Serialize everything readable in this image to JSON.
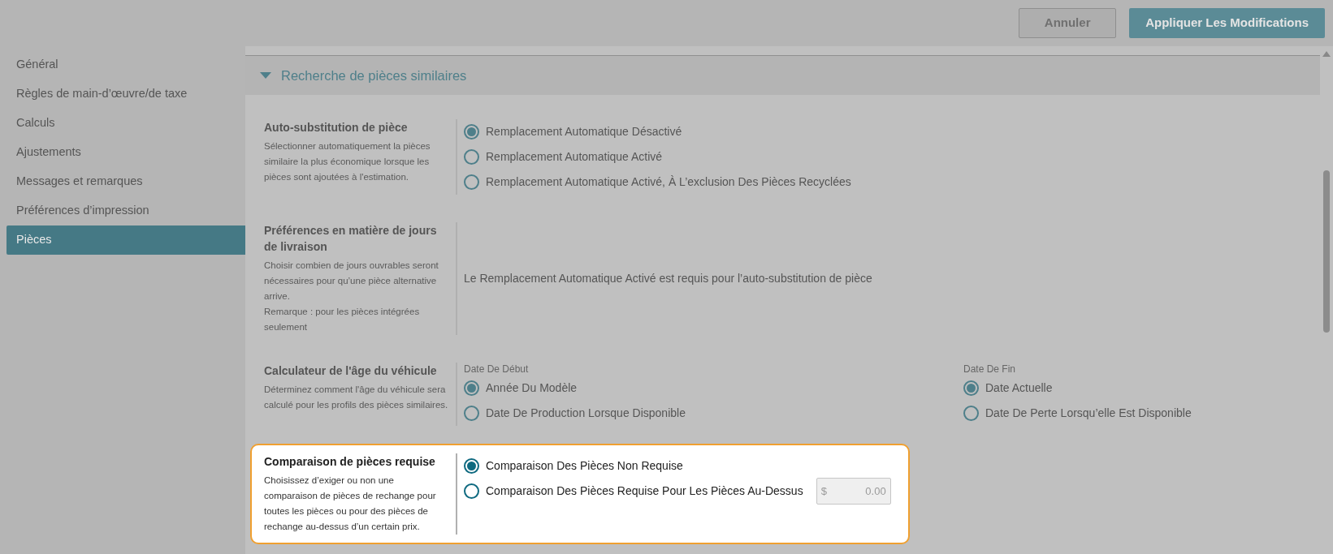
{
  "header": {
    "buttons": [
      {
        "label": "Annuler",
        "kind": "secondary"
      },
      {
        "label": "Appliquer Les Modifications",
        "kind": "primary"
      }
    ]
  },
  "sidebar": {
    "items": [
      {
        "label": "Général",
        "selected": false
      },
      {
        "label": "Règles de main-d’œuvre/de taxe",
        "selected": false
      },
      {
        "label": "Calculs",
        "selected": false
      },
      {
        "label": "Ajustements",
        "selected": false
      },
      {
        "label": "Messages et remarques",
        "selected": false
      },
      {
        "label": "Préférences d’impression",
        "selected": false
      },
      {
        "label": "Pièces",
        "selected": true
      }
    ]
  },
  "section": {
    "title": "Recherche de pièces similaires",
    "expanded": true,
    "settings": [
      {
        "kind": "radio",
        "highlighted": false,
        "title": "Auto-substitution de pièce",
        "description": [
          "Sélectionner automatiquement la pièces similaire la plus économique lorsque les pièces sont ajoutées à l'estimation."
        ],
        "options": [
          {
            "label": "Remplacement Automatique Désactivé",
            "selected": true
          },
          {
            "label": "Remplacement Automatique Activé",
            "selected": false
          },
          {
            "label": "Remplacement Automatique Activé, À L’exclusion Des Pièces Recyclées",
            "selected": false
          }
        ]
      },
      {
        "kind": "message",
        "highlighted": false,
        "title": "Préférences en matière de jours de livraison",
        "description": [
          "Choisir combien de jours ouvrables seront nécessaires pour qu’une pièce alternative arrive.",
          "Remarque : pour les pièces intégrées seulement"
        ],
        "message": "Le Remplacement Automatique Activé est requis pour l’auto-substitution de pièce"
      },
      {
        "kind": "date_range",
        "highlighted": false,
        "title": "Calculateur de l'âge du véhicule",
        "description": [
          "Déterminez comment l'âge du véhicule sera calculé pour les profils des pièces similaires."
        ],
        "groups": [
          {
            "label": "Date De Début",
            "options": [
              {
                "label": "Année Du Modèle",
                "selected": true
              },
              {
                "label": "Date De Production Lorsque Disponible",
                "selected": false
              }
            ]
          },
          {
            "label": "Date De Fin",
            "options": [
              {
                "label": "Date Actuelle",
                "selected": true
              },
              {
                "label": "Date De Perte Lorsqu’elle Est Disponible",
                "selected": false
              }
            ]
          }
        ]
      },
      {
        "kind": "radio",
        "highlighted": true,
        "title": "Comparaison de pièces requise",
        "description": [
          "Choisissez d’exiger ou non une comparaison de pièces de rechange pour toutes les pièces ou pour des pièces de rechange au-dessus d’un certain prix."
        ],
        "options": [
          {
            "label": "Comparaison Des Pièces Non Requise",
            "selected": true
          },
          {
            "label": "Comparaison Des Pièces Requise Pour Les Pièces Au-Dessus",
            "selected": false,
            "field": {
              "prefix": "$",
              "value": "0.00",
              "disabled": true
            }
          }
        ]
      }
    ]
  }
}
